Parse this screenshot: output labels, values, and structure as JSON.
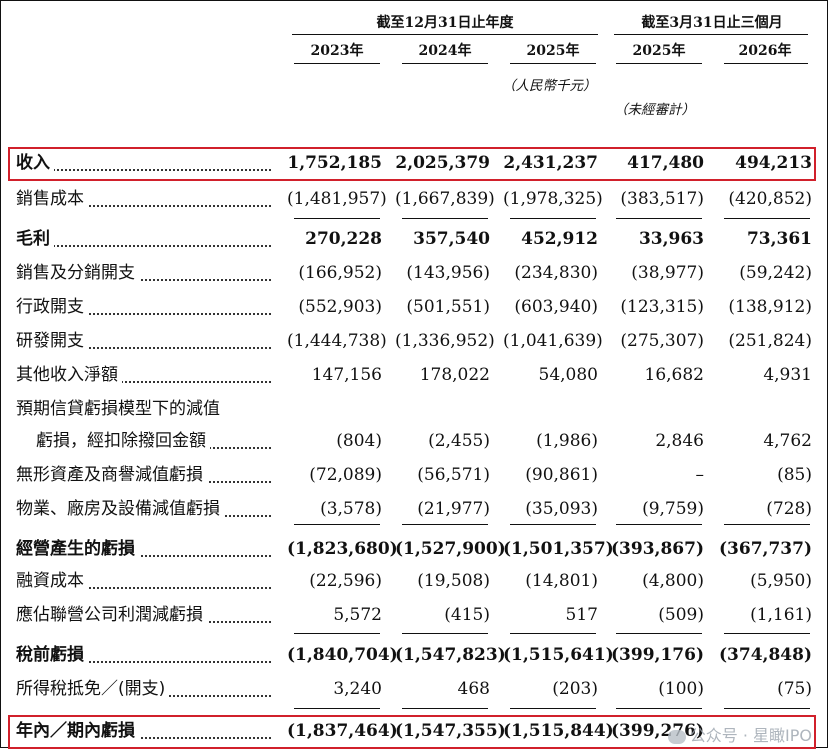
{
  "header": {
    "group1": "截至12月31日止年度",
    "group2": "截至3月31日止三個月",
    "years": [
      "2023年",
      "2024年",
      "2025年",
      "2025年",
      "2026年"
    ],
    "currency_note": "（人民幣千元）",
    "unaudited_note": "（未經審計）"
  },
  "rows": [
    {
      "label": "收入",
      "values": [
        "1,752,185",
        "2,025,379",
        "2,431,237",
        "417,480",
        "494,213"
      ]
    },
    {
      "label": "銷售成本",
      "values": [
        "(1,481,957)",
        "(1,667,839)",
        "(1,978,325)",
        "(383,517)",
        "(420,852)"
      ]
    },
    {
      "label": "毛利",
      "values": [
        "270,228",
        "357,540",
        "452,912",
        "33,963",
        "73,361"
      ]
    },
    {
      "label": "銷售及分銷開支",
      "values": [
        "(166,952)",
        "(143,956)",
        "(234,830)",
        "(38,977)",
        "(59,242)"
      ]
    },
    {
      "label": "行政開支",
      "values": [
        "(552,903)",
        "(501,551)",
        "(603,940)",
        "(123,315)",
        "(138,912)"
      ]
    },
    {
      "label": "研發開支",
      "values": [
        "(1,444,738)",
        "(1,336,952)",
        "(1,041,639)",
        "(275,307)",
        "(251,824)"
      ]
    },
    {
      "label": "其他收入淨額",
      "values": [
        "147,156",
        "178,022",
        "54,080",
        "16,682",
        "4,931"
      ]
    },
    {
      "label": "預期信貸虧損模型下的減值",
      "values": [
        "",
        "",
        "",
        "",
        ""
      ]
    },
    {
      "label": "虧損，經扣除撥回金額",
      "values": [
        "(804)",
        "(2,455)",
        "(1,986)",
        "2,846",
        "4,762"
      ]
    },
    {
      "label": "無形資產及商譽減值虧損",
      "values": [
        "(72,089)",
        "(56,571)",
        "(90,861)",
        "–",
        "(85)"
      ]
    },
    {
      "label": "物業、廠房及設備減值虧損",
      "values": [
        "(3,578)",
        "(21,977)",
        "(35,093)",
        "(9,759)",
        "(728)"
      ]
    },
    {
      "label": "經營產生的虧損",
      "values": [
        "(1,823,680)",
        "(1,527,900)",
        "(1,501,357)",
        "(393,867)",
        "(367,737)"
      ]
    },
    {
      "label": "融資成本",
      "values": [
        "(22,596)",
        "(19,508)",
        "(14,801)",
        "(4,800)",
        "(5,950)"
      ]
    },
    {
      "label": "應佔聯營公司利潤減虧損",
      "values": [
        "5,572",
        "(415)",
        "517",
        "(509)",
        "(1,161)"
      ]
    },
    {
      "label": "稅前虧損",
      "values": [
        "(1,840,704)",
        "(1,547,823)",
        "(1,515,641)",
        "(399,176)",
        "(374,848)"
      ]
    },
    {
      "label": "所得稅抵免／(開支)",
      "values": [
        "3,240",
        "468",
        "(203)",
        "(100)",
        "(75)"
      ]
    },
    {
      "label": "年內／期內虧損",
      "values": [
        "(1,837,464)",
        "(1,547,355)",
        "(1,515,844)",
        "(399,276)",
        ""
      ]
    }
  ],
  "watermark": "公众号 · 星瞰IPO"
}
